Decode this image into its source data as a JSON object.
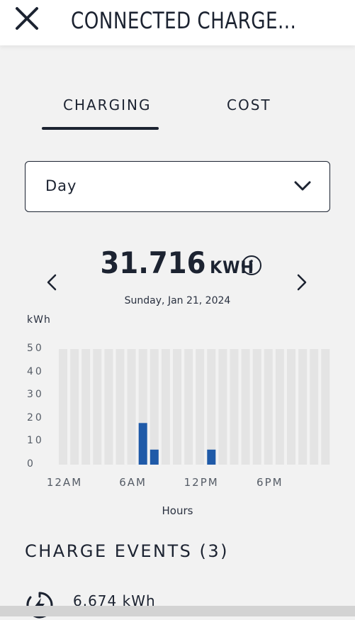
{
  "header": {
    "title": "CONNECTED CHARGE...",
    "close_icon": "close-icon"
  },
  "tabs": [
    {
      "label": "CHARGING",
      "active": true
    },
    {
      "label": "COST",
      "active": false
    }
  ],
  "period_select": {
    "value": "Day",
    "icon": "chevron-down-icon"
  },
  "summary": {
    "total": "31.716",
    "unit": "KWH",
    "date": "Sunday, Jan 21, 2024"
  },
  "chart_data": {
    "type": "bar",
    "ylabel": "kWh",
    "xlabel": "Hours",
    "ylim": [
      0,
      50
    ],
    "yticks": [
      "50",
      "40",
      "30",
      "20",
      "10",
      "0"
    ],
    "xtick_labels": [
      "12AM",
      "6AM",
      "12PM",
      "6PM"
    ],
    "categories": [
      "12AM",
      "1AM",
      "2AM",
      "3AM",
      "4AM",
      "5AM",
      "6AM",
      "7AM",
      "8AM",
      "9AM",
      "10AM",
      "11AM",
      "12PM",
      "1PM",
      "2PM",
      "3PM",
      "4PM",
      "5PM",
      "6PM",
      "7PM",
      "8PM",
      "9PM",
      "10PM",
      "11PM"
    ],
    "values": [
      0,
      0,
      0,
      0,
      0,
      0,
      0,
      18,
      6.5,
      0,
      0,
      0,
      0,
      6.5,
      0,
      0,
      0,
      0,
      0,
      0,
      0,
      0,
      0,
      0
    ],
    "bar_color": "#1f5aa8",
    "background_color": "#e4e4e4"
  },
  "events": {
    "title": "CHARGE EVENTS (3)",
    "items": [
      {
        "value": "6.674 kWh",
        "icon": "charging-timer-icon"
      }
    ]
  }
}
